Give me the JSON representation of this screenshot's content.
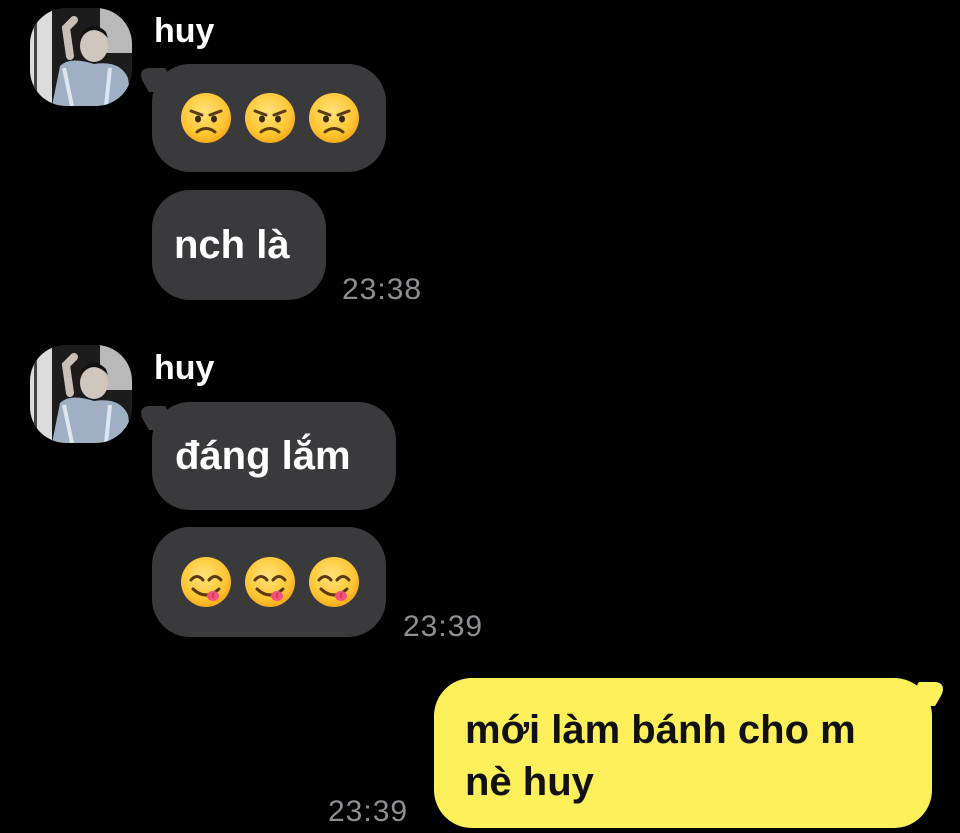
{
  "colors": {
    "background": "#000000",
    "incoming_bubble": "#3a3a3c",
    "outgoing_bubble": "#fdf05a",
    "time_text": "#8e8e93"
  },
  "groups": [
    {
      "sender": "huy",
      "messages": [
        {
          "kind": "emoji",
          "emojis": [
            "angry-face",
            "angry-face",
            "angry-face"
          ]
        },
        {
          "kind": "text",
          "text": "nch là"
        }
      ],
      "time": "23:38"
    },
    {
      "sender": "huy",
      "messages": [
        {
          "kind": "text",
          "text": "đáng lắm"
        },
        {
          "kind": "emoji",
          "emojis": [
            "face-savoring-food",
            "face-savoring-food",
            "face-savoring-food"
          ]
        }
      ],
      "time": "23:39"
    }
  ],
  "outgoing": {
    "lines": [
      "mới làm bánh cho m",
      "nè huy"
    ],
    "time": "23:39"
  }
}
